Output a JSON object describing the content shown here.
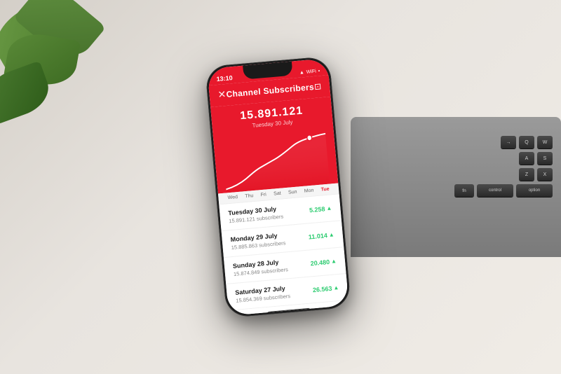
{
  "desk": {
    "background": "#e8e4df"
  },
  "plant": {
    "description": "green tropical plant leaves"
  },
  "keyboard": {
    "rows": [
      [
        "→",
        "Q",
        "W"
      ],
      [
        "A",
        "S"
      ],
      [
        "Z",
        "X"
      ],
      [
        "fn",
        "control",
        "option"
      ]
    ]
  },
  "phone": {
    "status_bar": {
      "time": "13:10",
      "icons": [
        "▲",
        "WiFi",
        "Battery"
      ]
    },
    "header": {
      "close_icon": "✕",
      "title": "Channel Subscribers",
      "camera_icon": "⊡"
    },
    "chart": {
      "value": "15.891.121",
      "date": "Tuesday 30 July"
    },
    "day_labels": [
      "Wed",
      "Thu",
      "Fri",
      "Sat",
      "Sun",
      "Mon",
      "Tue"
    ],
    "active_day": "Tue",
    "list_items": [
      {
        "date": "Tuesday 30 July",
        "subscribers": "15.891.121 subscribers",
        "count": "5.258",
        "trend": "+"
      },
      {
        "date": "Monday 29 July",
        "subscribers": "15.885.863 subscribers",
        "count": "11.014",
        "trend": "+"
      },
      {
        "date": "Sunday 28 July",
        "subscribers": "15.874.849 subscribers",
        "count": "20.480",
        "trend": "+"
      },
      {
        "date": "Saturday 27 July",
        "subscribers": "15.854.369 subscribers",
        "count": "26.563",
        "trend": "+"
      }
    ]
  }
}
